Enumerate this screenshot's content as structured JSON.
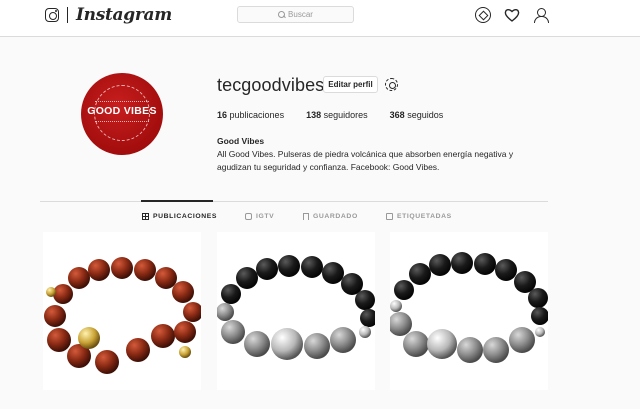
{
  "topbar": {
    "wordmark": "Instagram",
    "search_placeholder": "Buscar",
    "icons": [
      "instagram-glyph-icon",
      "compass-icon",
      "heart-icon",
      "person-icon"
    ]
  },
  "profile": {
    "username": "tecgoodvibes",
    "edit_label": "Editar perfil",
    "avatar_text": "GOOD VIBES",
    "stats": [
      {
        "count": "16",
        "label": "publicaciones"
      },
      {
        "count": "138",
        "label": "seguidores"
      },
      {
        "count": "368",
        "label": "seguidos"
      }
    ],
    "bio_name": "Good Vibes",
    "bio_line1": "All Good Vibes. Pulseras de piedra volcánica que absorben energía negativa y",
    "bio_line2": "agudizan tu seguridad y confianza. Facebook: Good Vibes."
  },
  "tabs": [
    {
      "label": "PUBLICACIONES",
      "active": true
    },
    {
      "label": "IGTV",
      "active": false
    },
    {
      "label": "GUARDADO",
      "active": false
    },
    {
      "label": "ETIQUETADAS",
      "active": false
    }
  ],
  "posts": [
    {
      "name": "red-tiger-eye-bracelet",
      "bead_color": "#8a2a14",
      "accent": "#c9a235"
    },
    {
      "name": "black-lava-lion-bracelet",
      "bead_color": "#1a1a1a",
      "accent": "#8e8e8e"
    },
    {
      "name": "black-lava-spartan-bracelet",
      "bead_color": "#1a1a1a",
      "accent": "#8e8e8e"
    }
  ],
  "colors": {
    "avatar_red": "#a30d0d",
    "border": "#dbdbdb",
    "text": "#262626",
    "muted": "#999999"
  }
}
